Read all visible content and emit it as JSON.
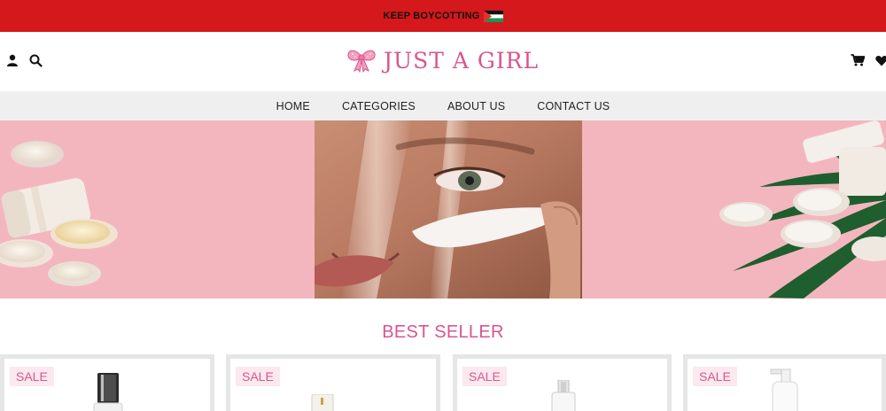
{
  "announcement": {
    "text": "KEEP BOYCOTTING"
  },
  "header": {
    "brand": "JUST A GIRL",
    "icons": [
      "user-icon",
      "search-icon",
      "cart-icon",
      "heart-icon"
    ]
  },
  "nav": {
    "items": [
      {
        "label": "HOME"
      },
      {
        "label": "CATEGORIES"
      },
      {
        "label": "ABOUT US"
      },
      {
        "label": "CONTACT US"
      }
    ]
  },
  "best_seller": {
    "title": "BEST SELLER",
    "products": [
      {
        "badge": "SALE"
      },
      {
        "badge": "SALE"
      },
      {
        "badge": "SALE"
      },
      {
        "badge": "SALE"
      }
    ]
  },
  "colors": {
    "announcement_bg": "#d4181b",
    "brand_pink": "#d9558f",
    "hero_pink": "#f4b6be",
    "nav_bg": "#efefef"
  }
}
